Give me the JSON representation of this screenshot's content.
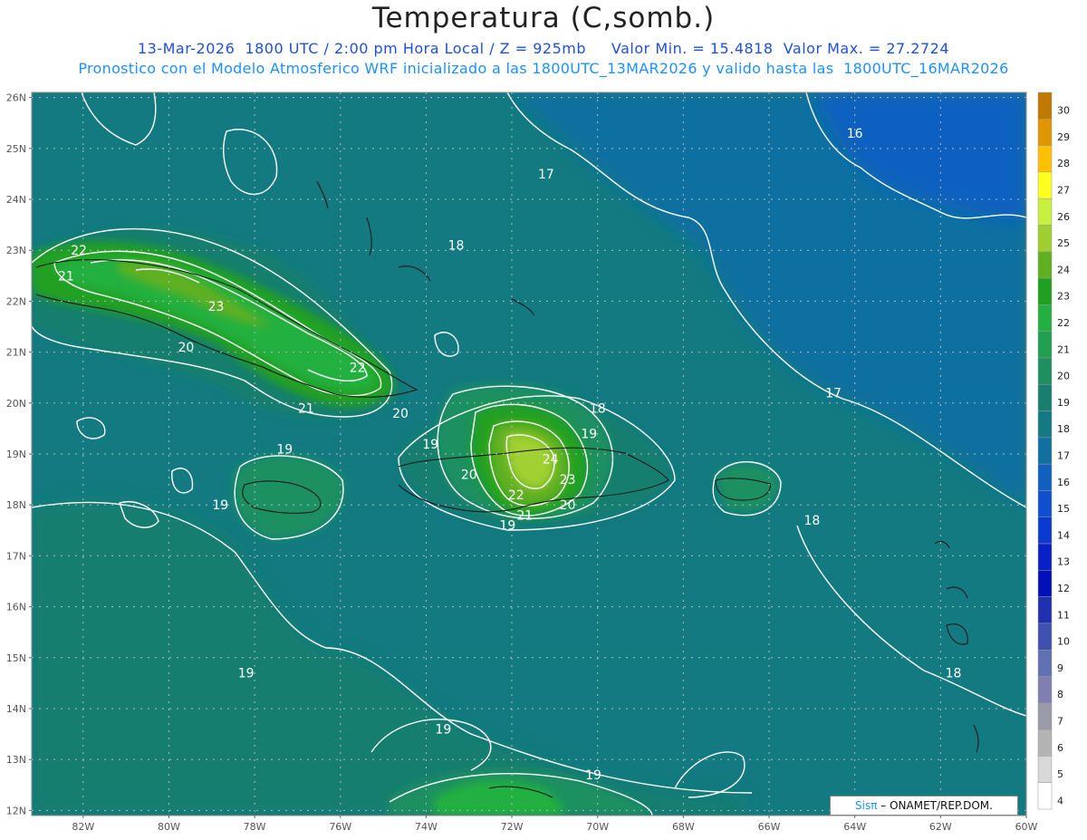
{
  "title": "Temperatura (C,somb.)",
  "subtitle_line1": "13-Mar-2026  1800 UTC / 2:00 pm Hora Local / Z = 925mb     Valor Min. = 15.4818  Valor Max. = 27.2724",
  "subtitle_line2": "Pronostico con el Modelo Atmosferico WRF inicializado a las 1800UTC_13MAR2026 y valido hasta las  1800UTC_16MAR2026",
  "credit": {
    "brand": "Sisπ",
    "text": " – ONAMET/REP.DOM."
  },
  "map": {
    "lon_range": [
      -83.2,
      -60
    ],
    "lat_range": [
      11.9,
      26.1
    ],
    "lat_ticks": [
      "12N",
      "13N",
      "14N",
      "15N",
      "16N",
      "17N",
      "18N",
      "19N",
      "20N",
      "21N",
      "22N",
      "23N",
      "24N",
      "25N",
      "26N"
    ],
    "lon_ticks": [
      "82W",
      "80W",
      "78W",
      "76W",
      "74W",
      "72W",
      "70W",
      "68W",
      "66W",
      "64W",
      "62W",
      "60W"
    ],
    "contour_labels": [
      {
        "text": "16",
        "lon": -64,
        "lat": 25.3
      },
      {
        "text": "17",
        "lon": -71.2,
        "lat": 24.5
      },
      {
        "text": "17",
        "lon": -64.5,
        "lat": 20.2
      },
      {
        "text": "18",
        "lon": -73.3,
        "lat": 23.1
      },
      {
        "text": "18",
        "lon": -70,
        "lat": 19.9
      },
      {
        "text": "18",
        "lon": -65,
        "lat": 17.7
      },
      {
        "text": "18",
        "lon": -61.7,
        "lat": 14.7
      },
      {
        "text": "22",
        "lon": -82.1,
        "lat": 23
      },
      {
        "text": "21",
        "lon": -82.4,
        "lat": 22.5
      },
      {
        "text": "23",
        "lon": -78.9,
        "lat": 21.9
      },
      {
        "text": "20",
        "lon": -79.6,
        "lat": 21.1
      },
      {
        "text": "22",
        "lon": -75.6,
        "lat": 20.7
      },
      {
        "text": "21",
        "lon": -76.8,
        "lat": 19.9
      },
      {
        "text": "20",
        "lon": -74.6,
        "lat": 19.8
      },
      {
        "text": "19",
        "lon": -77.3,
        "lat": 19.1
      },
      {
        "text": "19",
        "lon": -73.9,
        "lat": 19.2
      },
      {
        "text": "19",
        "lon": -70.2,
        "lat": 19.4
      },
      {
        "text": "24",
        "lon": -71.1,
        "lat": 18.9
      },
      {
        "text": "23",
        "lon": -70.7,
        "lat": 18.5
      },
      {
        "text": "22",
        "lon": -71.9,
        "lat": 18.2
      },
      {
        "text": "21",
        "lon": -71.7,
        "lat": 17.8
      },
      {
        "text": "20",
        "lon": -70.7,
        "lat": 18.0
      },
      {
        "text": "20",
        "lon": -73.0,
        "lat": 18.6
      },
      {
        "text": "19",
        "lon": -72.1,
        "lat": 17.6
      },
      {
        "text": "19",
        "lon": -78.8,
        "lat": 18.0
      },
      {
        "text": "19",
        "lon": -78.2,
        "lat": 14.7
      },
      {
        "text": "19",
        "lon": -73.6,
        "lat": 13.6
      },
      {
        "text": "19",
        "lon": -70.1,
        "lat": 12.7
      }
    ]
  },
  "colorbar": {
    "labels": [
      "30",
      "29",
      "28",
      "27",
      "26",
      "25",
      "24",
      "23",
      "22",
      "21",
      "20",
      "19",
      "18",
      "17",
      "16",
      "15",
      "14",
      "13",
      "12",
      "11",
      "10",
      "9",
      "8",
      "7",
      "6",
      "5",
      "4"
    ],
    "colors": [
      "#c07800",
      "#e09600",
      "#ffc000",
      "#ffff20",
      "#c8f040",
      "#a0d030",
      "#60b020",
      "#20a020",
      "#24b040",
      "#20a050",
      "#1e9060",
      "#187e6e",
      "#127a80",
      "#1070a0",
      "#1060c0",
      "#0e50d0",
      "#0a3ad0",
      "#0820c8",
      "#0010b8",
      "#2030b0",
      "#4050b0",
      "#6070b0",
      "#8080b0",
      "#9a9aa8",
      "#b4b4b4",
      "#d8d8d8",
      "#ffffff"
    ]
  }
}
